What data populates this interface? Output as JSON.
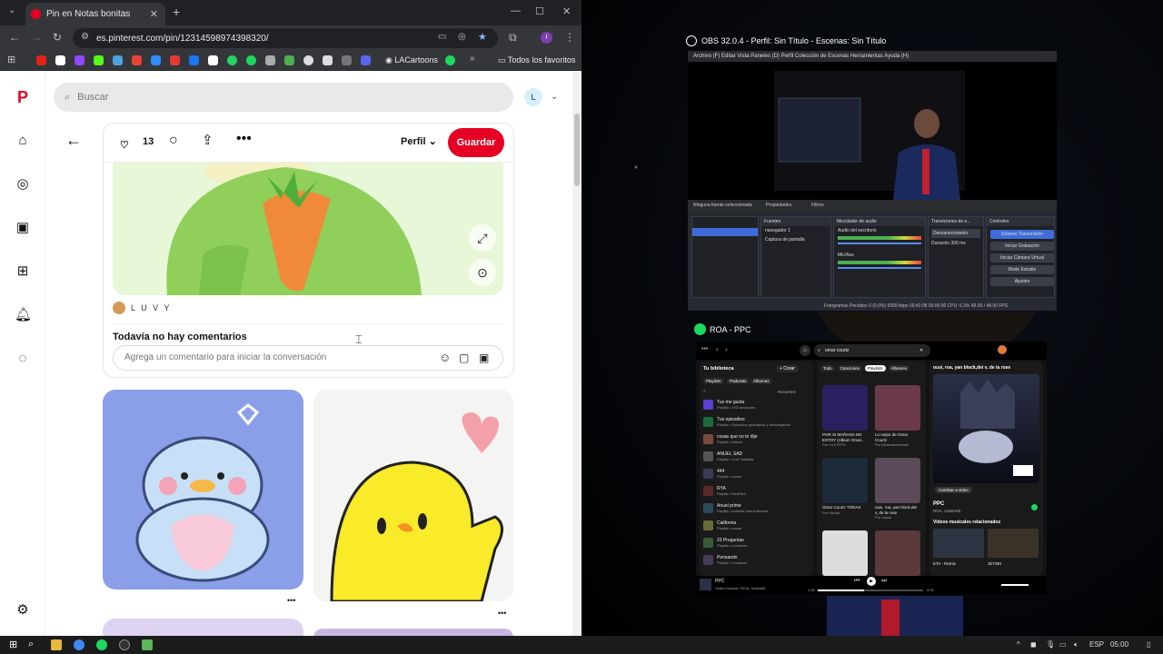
{
  "browser": {
    "tab_title": "Pin en Notas bonitas",
    "url": "es.pinterest.com/pin/12314598974398320/",
    "bookmarks": [
      "LACartoons",
      "Todos los favoritos"
    ]
  },
  "pinterest": {
    "search_placeholder": "Buscar",
    "avatar_letter": "L",
    "likes_count": "13",
    "profile_label": "Perfil",
    "save_label": "Guardar",
    "creator_name": "L U V Y",
    "comments_title": "Todavía no hay comentarios",
    "comment_placeholder": "Agrega un comentario para iniciar la conversación"
  },
  "obs": {
    "window_title": "OBS 32.0.4 - Perfil: Sin Título - Escenas: Sin Título",
    "menu": "Archivo (F)  Editar  Vista  Paneles (D)  Perfil  Colección de Escenas  Herramientas  Ayuda (H)",
    "docks": {
      "sources_header": "Fuentes",
      "source_1": "navegador 1",
      "source_2": "Captura de pantalla",
      "mixer_header": "Mezclador de audio",
      "mixer_1": "Audio del escritorio",
      "mixer_2": "Mic/Aux",
      "transitions_header": "Transiciones de e...",
      "transition_value": "Desvanecimiento",
      "duration_label": "Duración",
      "duration_value": "300 ms",
      "controls_header": "Controles",
      "btn_stop_stream": "Detener Transmisión",
      "btn_start_rec": "Iniciar Grabación",
      "btn_virtual_cam": "Iniciar Cámara Virtual",
      "btn_studio": "Modo Estudio",
      "btn_settings": "Ajustes",
      "no_source": "Ninguna fuente seleccionada",
      "properties": "Propiedades",
      "filters": "Filtros"
    },
    "status": "Fotogramas Perdidos 0 (0.0%)   5099 kbps   00:42:08   00:00:00   CPU: 6.3%   48.00 / 48.00 FPS"
  },
  "spotify": {
    "window_title": "ROA - PPC",
    "search_value": "omar courtz",
    "library_title": "Tu biblioteca",
    "create_label": "+ Crear",
    "filters": [
      "Playlists",
      "Podcasts",
      "Álbumes"
    ],
    "recent_label": "Recientes",
    "library": [
      {
        "title": "Tus me gusta",
        "sub": "Playlist • 493 canciones",
        "color": "#5b3fd1"
      },
      {
        "title": "Tus episodios",
        "sub": "Playlist • Episodios guardados y descargados",
        "color": "#1d6b3a"
      },
      {
        "title": "cosas que no te dije",
        "sub": "Playlist • Maxzo",
        "color": "#7a4a3a"
      },
      {
        "title": "ANUEL SAD",
        "sub": "Playlist • Jose Saldaña",
        "color": "#555"
      },
      {
        "title": "444",
        "sub": "Playlist • ocean",
        "color": "#3a3a5a"
      },
      {
        "title": "RYA",
        "sub": "Playlist • RedFar0",
        "color": "#5a2a2a"
      },
      {
        "title": "Anuel prime",
        "sub": "Playlist • Isabella Sierra Atencia",
        "color": "#2a4a5a"
      },
      {
        "title": "California",
        "sub": "Playlist • ocean",
        "color": "#6a6a3a"
      },
      {
        "title": "23 Preguntas",
        "sub": "Playlist • Lechavez",
        "color": "#3a5a3a"
      },
      {
        "title": "Pensando",
        "sub": "Playlist • Lechavez",
        "color": "#4a3a5a"
      }
    ],
    "tabs": [
      "Todo",
      "Canciones",
      "Playlists",
      "Álbumes"
    ],
    "cards": [
      {
        "title": "POR SI MAÑANA NO ESTOY (Album Omar...",
        "sub": "Por LUCYFFX"
      },
      {
        "title": "Lo mejor de Omar Courtz",
        "sub": "Por lukasdavimemail"
      },
      {
        "title": "Omar Courtz TODAS",
        "sub": "Por Harold"
      },
      {
        "title": "ousi, roa, yan block,dei v, de la rose",
        "sub": "Por Iviaaa"
      },
      {
        "title": "THIS IS",
        "sub": ""
      },
      {
        "title": "",
        "sub": ""
      }
    ],
    "now_header": "ousi, roa, yan block,dei v, de la rose",
    "change_video": "Cambiar a video",
    "song_title": "PPC",
    "song_artists": "ROA, Hades66",
    "related_title": "Videos musicales relacionados",
    "related": [
      "ETA - Remix",
      "JETSKI"
    ],
    "player_title": "PPC",
    "player_sub": "Video musical • ROA, Hades66",
    "time_elapsed": "1:46",
    "time_total": "4:00",
    "progress": 0.44
  },
  "taskbar": {
    "lang": "ESP",
    "time": "05:00"
  }
}
